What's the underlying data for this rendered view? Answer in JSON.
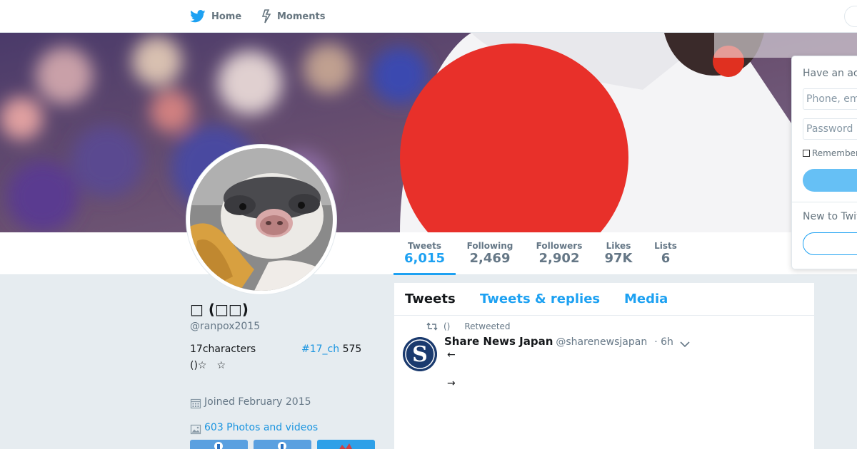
{
  "nav": {
    "home_label": "Home",
    "moments_label": "Moments"
  },
  "profile_nav": {
    "stats": [
      {
        "label": "Tweets",
        "value": "6,015"
      },
      {
        "label": "Following",
        "value": "2,469"
      },
      {
        "label": "Followers",
        "value": "2,902"
      },
      {
        "label": "Likes",
        "value": "97K"
      },
      {
        "label": "Lists",
        "value": "6"
      }
    ]
  },
  "login": {
    "have_account": "Have an ac",
    "phone_placeholder": "Phone, em",
    "password_placeholder": "Password",
    "remember": "Remember",
    "new_to": "New to Twit"
  },
  "profile": {
    "name": "□ (□□)",
    "handle": "@ranpox2015",
    "bio_line1": "17characters",
    "bio_hashtag": "#17_ch",
    "bio_count": " 575",
    "bio_line2": "()☆　☆",
    "joined": "Joined February 2015",
    "photos": "603 Photos and videos"
  },
  "timeline": {
    "tabs": [
      "Tweets",
      "Tweets & replies",
      "Media"
    ],
    "retweet_paren": "()",
    "retweet_label": "Retweeted",
    "tweet": {
      "fullname": "Share News Japan",
      "username": "@sharenewsjapan",
      "time": "· 6h",
      "line1": "←",
      "line2": "→"
    }
  },
  "colors": {
    "accent": "#1da1f2",
    "link": "#1b95e0",
    "background": "#e6ecf0"
  }
}
